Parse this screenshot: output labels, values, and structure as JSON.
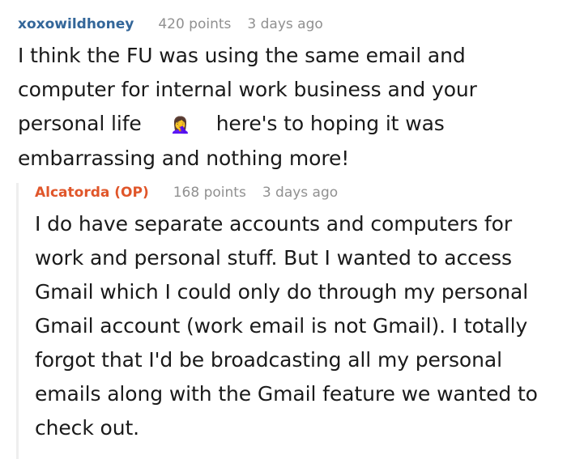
{
  "comments": [
    {
      "author": "xoxowildhoney",
      "points": "420 points",
      "time": "3 days ago",
      "text_before": "I think the FU was using the same email and computer for internal work business and your personal life",
      "emoji": "🤦‍♀️",
      "text_after": "here's to hoping it was embarrassing and nothing more!"
    },
    {
      "author": "Alcatorda (OP)",
      "points": "168 points",
      "time": "3 days ago",
      "text": "I do have separate accounts and computers for work and personal stuff. But I wanted to access Gmail which I could only do through my personal Gmail account (work email is not Gmail). I totally forgot that I'd be broadcasting all my personal emails along with the Gmail feature we wanted to check out."
    }
  ]
}
